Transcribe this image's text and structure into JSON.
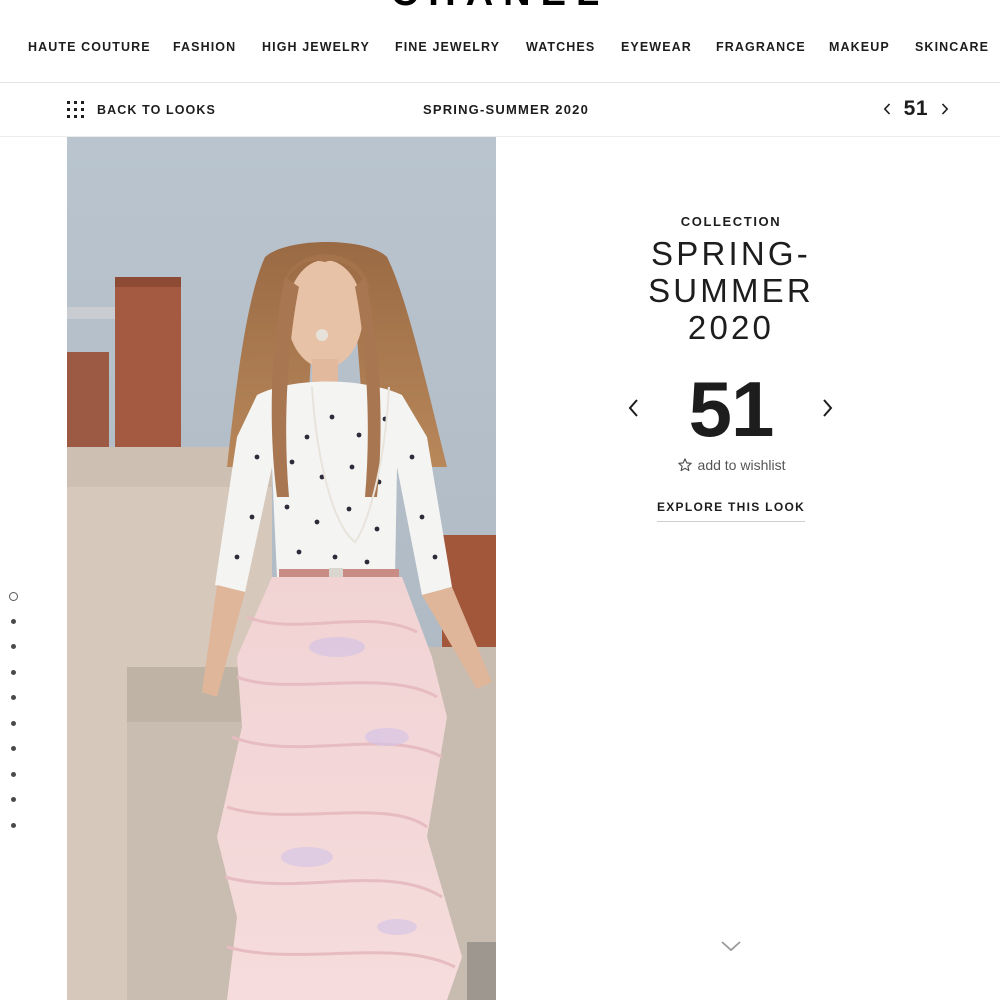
{
  "brand": {
    "name": "CHANEL"
  },
  "nav": {
    "items": [
      {
        "label": "HAUTE COUTURE"
      },
      {
        "label": "FASHION"
      },
      {
        "label": "HIGH JEWELRY"
      },
      {
        "label": "FINE JEWELRY"
      },
      {
        "label": "WATCHES"
      },
      {
        "label": "EYEWEAR"
      },
      {
        "label": "FRAGRANCE"
      },
      {
        "label": "MAKEUP"
      },
      {
        "label": "SKINCARE"
      }
    ]
  },
  "subbar": {
    "back_label": "BACK TO LOOKS",
    "title": "SPRING-SUMMER 2020",
    "look_number": "51"
  },
  "panel": {
    "collection_label": "COLLECTION",
    "collection_title": "SPRING-SUMMER 2020",
    "look_number": "51",
    "wishlist_label": "add to wishlist",
    "explore_label": "EXPLORE THIS LOOK"
  },
  "side_dots": {
    "count": 10,
    "active_index": 0
  },
  "icons": {
    "grid": "grid-icon",
    "prev": "chevron-left-icon",
    "next": "chevron-right-icon",
    "wishlist": "star-outline-icon",
    "scroll": "chevron-down-icon"
  }
}
